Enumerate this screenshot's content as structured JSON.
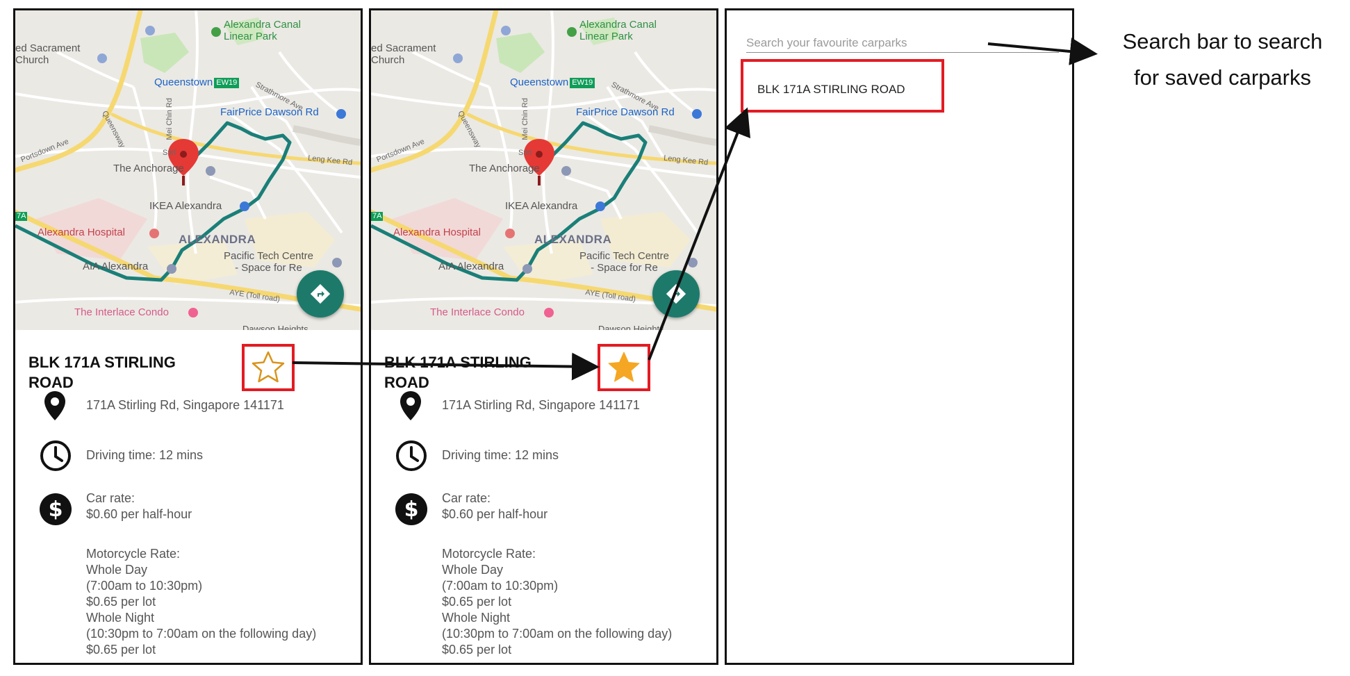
{
  "map": {
    "labels": {
      "church": "ed Sacrament\nChurch",
      "canal": "Alexandra Canal\nLinear Park",
      "queenstown": "Queenstown",
      "ew19": "EW19",
      "fairprice": "FairPrice Dawson Rd",
      "strathmore": "Strathmore Ave",
      "portsdown": "Portsdown Ave",
      "queensway": "Queensway",
      "meichin": "Mei Chin Rd",
      "stirl": "Stirl",
      "anchorage": "The Anchorage",
      "lengkee": "Leng Kee Rd",
      "ikea": "IKEA Alexandra",
      "hospital": "Alexandra Hospital",
      "alexandra": "ALEXANDRA",
      "pacific": "Pacific Tech Centre\n- Space for Re",
      "aia": "AIA Alexandra",
      "aye": "AYE (Toll road)",
      "interlace": "The Interlace Condo",
      "dawson_heights": "Dawson Heights",
      "sevena": "7A"
    },
    "colors": {
      "route": "#1a7f78",
      "pin": "#e53935",
      "fab": "#1d7a6b"
    }
  },
  "carpark": {
    "title": "BLK 171A STIRLING ROAD",
    "address": "171A Stirling Rd, Singapore 141171",
    "driving_time": "Driving time: 12 mins",
    "car_rate_label": "Car rate:",
    "car_rate_value": "$0.60 per half-hour",
    "moto_lines": [
      "Motorcycle Rate:",
      "Whole Day",
      "(7:00am to 10:30pm)",
      "$0.65 per lot",
      "Whole Night",
      "(10:30pm to 7:00am on the following day)",
      "$0.65 per lot"
    ]
  },
  "panels": {
    "before": {
      "favourite_state": "not-favourited",
      "star_icon": "star-outline-icon"
    },
    "after": {
      "favourite_state": "favourited",
      "star_icon": "star-filled-icon",
      "star_color": "#f5a623"
    }
  },
  "favourites": {
    "search_placeholder": "Search your favourite carparks",
    "results": [
      "BLK 171A STIRLING ROAD"
    ]
  },
  "annotation": {
    "callout_line1": "Search bar to search",
    "callout_line2": "for saved carparks",
    "highlight_color": "#e31b23"
  }
}
